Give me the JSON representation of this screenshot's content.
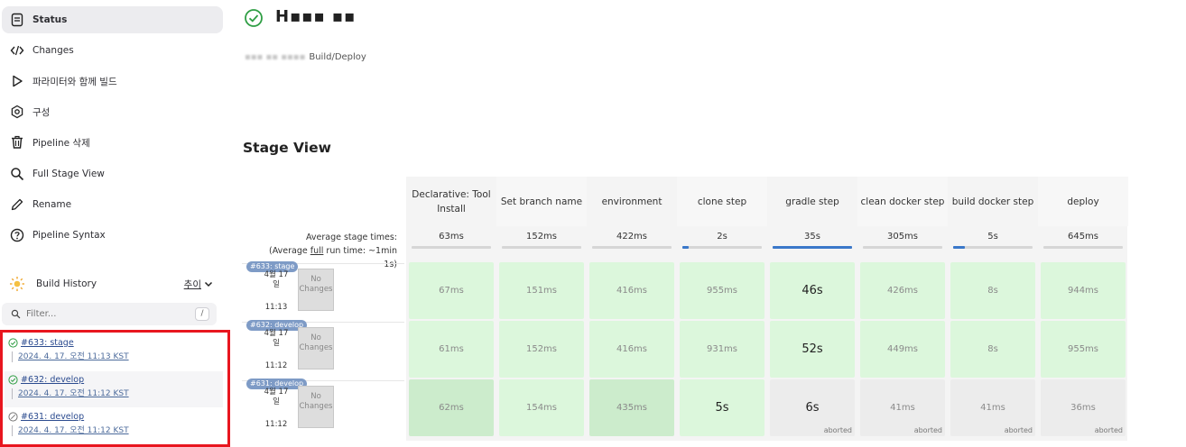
{
  "sidebar": {
    "items": [
      {
        "label": "Status",
        "icon": "document-icon"
      },
      {
        "label": "Changes",
        "icon": "code-icon"
      },
      {
        "label": "파라미터와 함께 빌드",
        "icon": "play-icon"
      },
      {
        "label": "구성",
        "icon": "gear-icon"
      },
      {
        "label": "Pipeline 삭제",
        "icon": "trash-icon"
      },
      {
        "label": "Full Stage View",
        "icon": "search-icon"
      },
      {
        "label": "Rename",
        "icon": "pencil-icon"
      },
      {
        "label": "Pipeline Syntax",
        "icon": "help-icon"
      }
    ]
  },
  "build_history": {
    "title": "Build History",
    "trend": "추이",
    "filter_placeholder": "Filter...",
    "filter_shortcut": "/",
    "builds": [
      {
        "name": "#633: stage",
        "date": "2024. 4. 17. 오전 11:13 KST",
        "status": "success"
      },
      {
        "name": "#632: develop",
        "date": "2024. 4. 17. 오전 11:12 KST",
        "status": "success"
      },
      {
        "name": "#631: develop",
        "date": "2024. 4. 17. 오전 11:12 KST",
        "status": "aborted"
      }
    ]
  },
  "main": {
    "title": "H▪▪▪ ▪▪",
    "breadcrumb_blurred": "▪▪▪ ▪▪ ▪▪▪▪",
    "breadcrumb_text": "Build/Deploy",
    "stage_view_title": "Stage View",
    "avg_label_1": "Average stage times:",
    "avg_label_2": "(Average ",
    "avg_label_full": "full",
    "avg_label_3": " run time: ~1min",
    "avg_label_4": "1s)"
  },
  "stages": [
    {
      "name": "Declarative: Tool Install",
      "avg": "63ms",
      "avg_fraction": 0
    },
    {
      "name": "Set branch name",
      "avg": "152ms",
      "avg_fraction": 0
    },
    {
      "name": "environment",
      "avg": "422ms",
      "avg_fraction": 0
    },
    {
      "name": "clone step",
      "avg": "2s",
      "avg_fraction": 0.08
    },
    {
      "name": "gradle step",
      "avg": "35s",
      "avg_fraction": 1
    },
    {
      "name": "clean docker step",
      "avg": "305ms",
      "avg_fraction": 0
    },
    {
      "name": "build docker step",
      "avg": "5s",
      "avg_fraction": 0.15
    },
    {
      "name": "deploy",
      "avg": "645ms",
      "avg_fraction": 0
    }
  ],
  "runs": [
    {
      "badge": "#633: stage",
      "date": "4월 17",
      "day": "일",
      "time": "11:13",
      "changes": "No Changes",
      "cells": [
        {
          "value": "67ms",
          "status": "success"
        },
        {
          "value": "151ms",
          "status": "success"
        },
        {
          "value": "416ms",
          "status": "success"
        },
        {
          "value": "955ms",
          "status": "success"
        },
        {
          "value": "46s",
          "status": "success",
          "highlight": true
        },
        {
          "value": "426ms",
          "status": "success"
        },
        {
          "value": "8s",
          "status": "success"
        },
        {
          "value": "944ms",
          "status": "success"
        }
      ]
    },
    {
      "badge": "#632: develop",
      "date": "4월 17",
      "day": "일",
      "time": "11:12",
      "changes": "No Changes",
      "cells": [
        {
          "value": "61ms",
          "status": "success"
        },
        {
          "value": "152ms",
          "status": "success"
        },
        {
          "value": "416ms",
          "status": "success"
        },
        {
          "value": "931ms",
          "status": "success"
        },
        {
          "value": "52s",
          "status": "success",
          "highlight": true
        },
        {
          "value": "449ms",
          "status": "success"
        },
        {
          "value": "8s",
          "status": "success"
        },
        {
          "value": "955ms",
          "status": "success"
        }
      ]
    },
    {
      "badge": "#631: develop",
      "date": "4월 17",
      "day": "일",
      "time": "11:12",
      "changes": "No Changes",
      "cells": [
        {
          "value": "62ms",
          "status": "success"
        },
        {
          "value": "154ms",
          "status": "success"
        },
        {
          "value": "435ms",
          "status": "success"
        },
        {
          "value": "5s",
          "status": "success",
          "highlight": true
        },
        {
          "value": "6s",
          "status": "aborted",
          "highlight": true,
          "label": "aborted"
        },
        {
          "value": "41ms",
          "status": "aborted",
          "label": "aborted"
        },
        {
          "value": "41ms",
          "status": "aborted",
          "label": "aborted"
        },
        {
          "value": "36ms",
          "status": "aborted",
          "label": "aborted"
        }
      ]
    }
  ],
  "colors": {
    "success_cell": "#dcf7dc",
    "aborted_cell": "#ececec",
    "badge": "#7e9bc6",
    "highlight_border": "#e8161f"
  }
}
